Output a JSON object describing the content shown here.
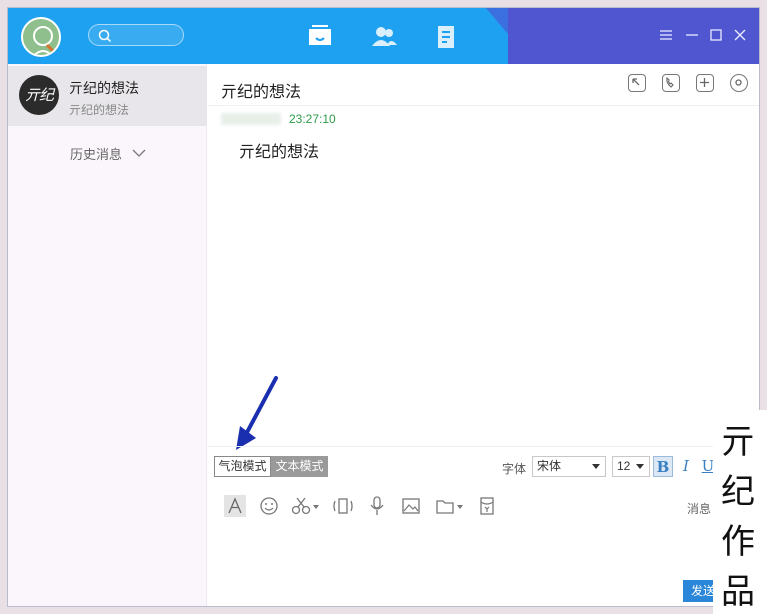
{
  "titlebar": {
    "search_placeholder": "",
    "nav": [
      "messages-tab",
      "contacts-tab",
      "notes-tab"
    ],
    "brand_color": "#1ea1f0",
    "accent_dark": "#4f56cf"
  },
  "sidebar": {
    "contact": {
      "name": "亓纪的想法",
      "preview": "亓纪的想法",
      "avatar_text": "亓纪"
    },
    "history_label": "历史消息"
  },
  "chat": {
    "title": "亓纪的想法",
    "message": {
      "time": "23:27:10",
      "text": "亓纪的想法"
    }
  },
  "compose": {
    "mode_bubble": "气泡模式",
    "mode_text": "文本模式",
    "font_label": "字体",
    "font_value": "宋体",
    "size_value": "12",
    "bold": "B",
    "italic": "I",
    "underline": "U",
    "message_label": "消息",
    "send_label": "发送"
  },
  "watermark": [
    "亓",
    "纪",
    "作",
    "品"
  ]
}
